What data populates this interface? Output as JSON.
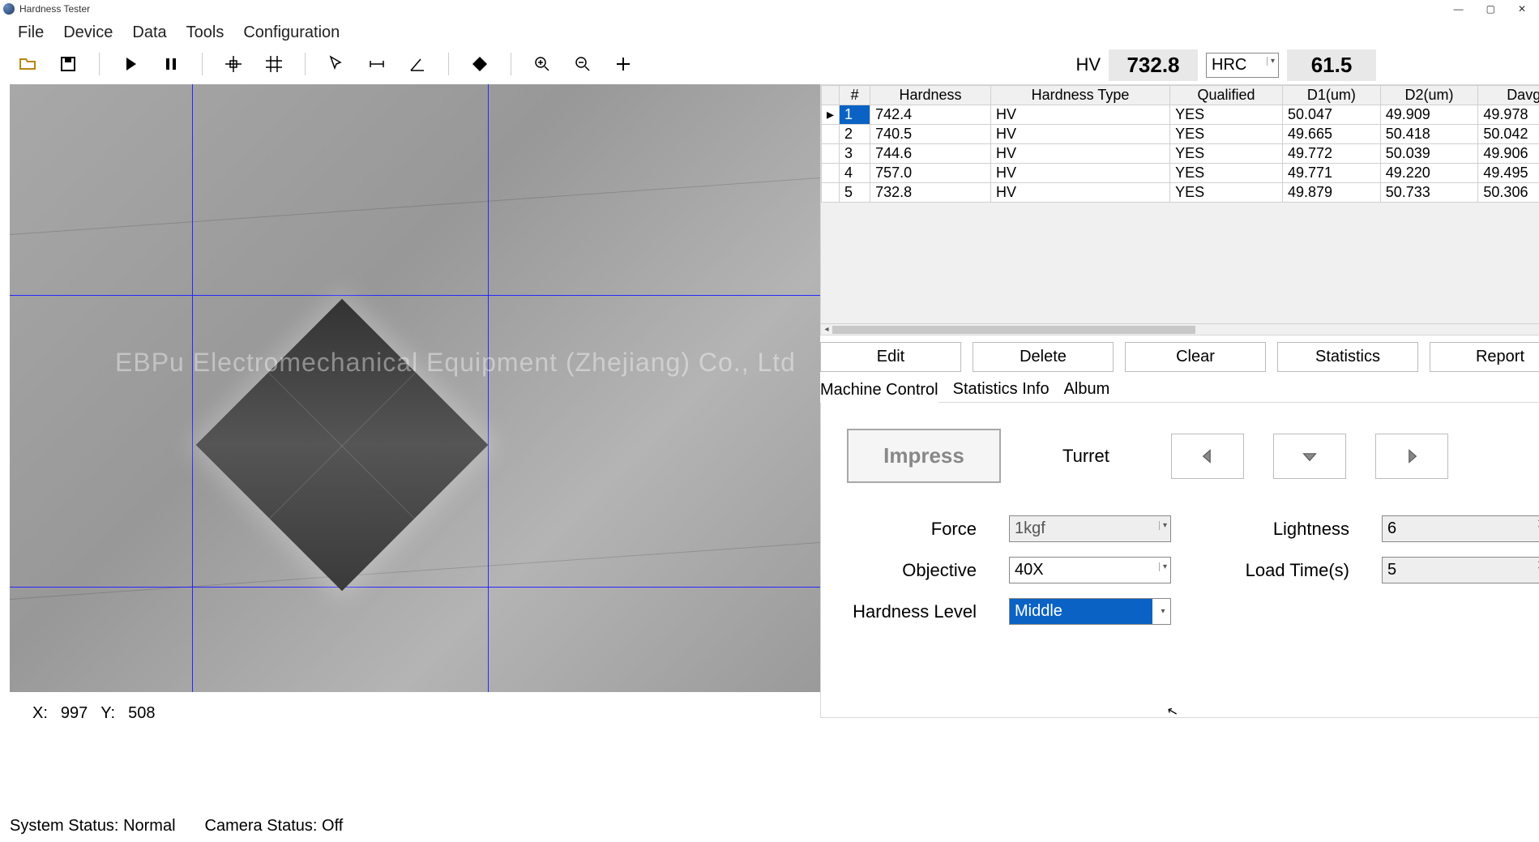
{
  "app": {
    "title": "Hardness Tester",
    "watermark": "EBPu Electromechanical Equipment (Zhejiang) Co., Ltd"
  },
  "menu": [
    "File",
    "Device",
    "Data",
    "Tools",
    "Configuration"
  ],
  "hv": {
    "label": "HV",
    "value": "732.8",
    "convert_type": "HRC",
    "convert_value": "61.5"
  },
  "table": {
    "headers": [
      "#",
      "Hardness",
      "Hardness Type",
      "Qualified",
      "D1(um)",
      "D2(um)",
      "Davg"
    ],
    "rows": [
      {
        "n": "1",
        "hardness": "742.4",
        "type": "HV",
        "q": "YES",
        "d1": "50.047",
        "d2": "49.909",
        "davg": "49.978"
      },
      {
        "n": "2",
        "hardness": "740.5",
        "type": "HV",
        "q": "YES",
        "d1": "49.665",
        "d2": "50.418",
        "davg": "50.042"
      },
      {
        "n": "3",
        "hardness": "744.6",
        "type": "HV",
        "q": "YES",
        "d1": "49.772",
        "d2": "50.039",
        "davg": "49.906"
      },
      {
        "n": "4",
        "hardness": "757.0",
        "type": "HV",
        "q": "YES",
        "d1": "49.771",
        "d2": "49.220",
        "davg": "49.495"
      },
      {
        "n": "5",
        "hardness": "732.8",
        "type": "HV",
        "q": "YES",
        "d1": "49.879",
        "d2": "50.733",
        "davg": "50.306"
      }
    ]
  },
  "buttons": {
    "edit": "Edit",
    "delete": "Delete",
    "clear": "Clear",
    "statistics": "Statistics",
    "report": "Report"
  },
  "tabs": {
    "machine": "Machine Control",
    "stats": "Statistics Info",
    "album": "Album"
  },
  "control": {
    "impress": "Impress",
    "turret": "Turret",
    "force_label": "Force",
    "force_value": "1kgf",
    "objective_label": "Objective",
    "objective_value": "40X",
    "hardness_level_label": "Hardness Level",
    "hardness_level_value": "Middle",
    "lightness_label": "Lightness",
    "lightness_value": "6",
    "loadtime_label": "Load Time(s)",
    "loadtime_value": "5"
  },
  "coord": {
    "x_label": "X:",
    "x_value": "997",
    "y_label": "Y:",
    "y_value": "508"
  },
  "status": {
    "system_label": "System Status:",
    "system_value": "Normal",
    "camera_label": "Camera Status:",
    "camera_value": "Off"
  }
}
